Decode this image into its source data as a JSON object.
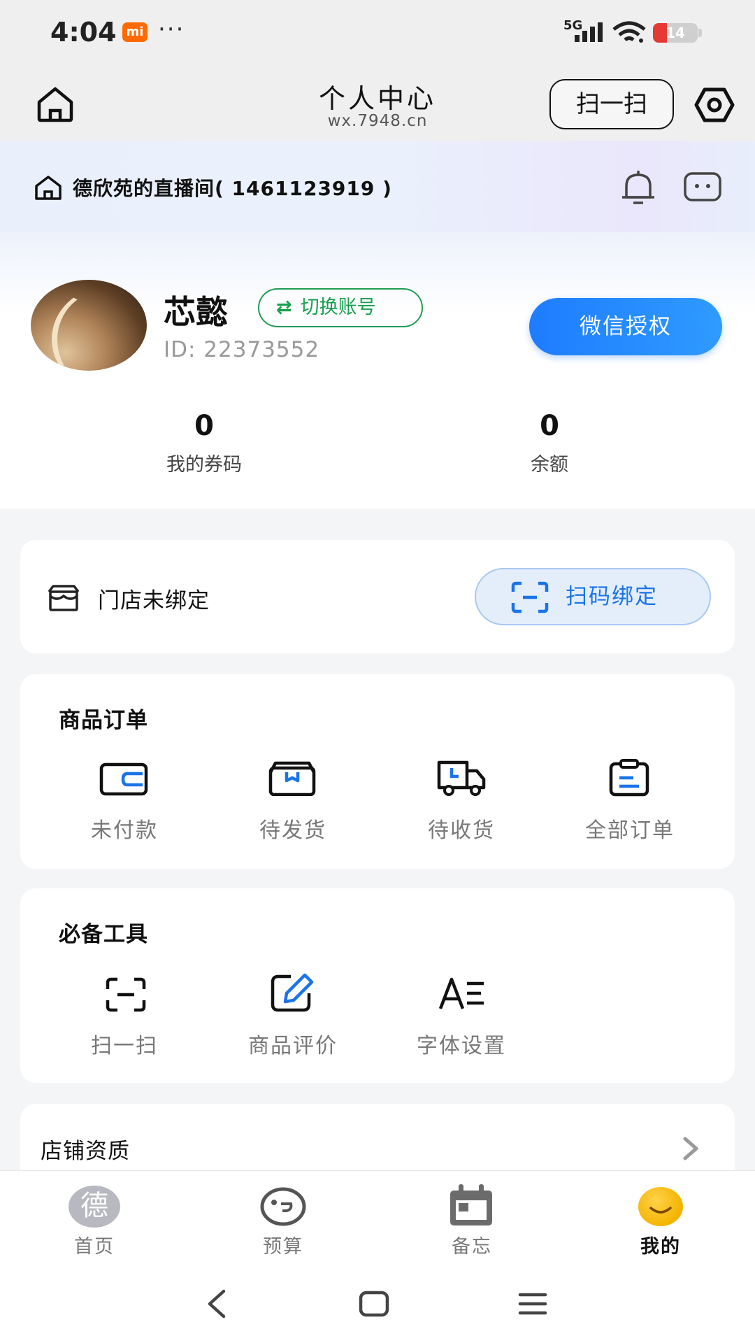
{
  "status_bar": {
    "time": "4:04",
    "mi_badge": "mi",
    "more": "···",
    "network": "5G",
    "battery": "14",
    "battery_level": 0.14,
    "battery_color": "#e53935"
  },
  "header": {
    "title": "个人中心",
    "subtitle": "wx.7948.cn",
    "scan_button": "扫一扫",
    "icons": [
      "home-icon",
      "settings-gear-icon"
    ]
  },
  "banner": {
    "live_room": "德欣苑的直播间( 1461123919 )",
    "icons": [
      "bell-icon",
      "message-icon"
    ]
  },
  "profile": {
    "name": "芯懿",
    "switch_button": "切换账号",
    "id_text": "ID: 22373552",
    "wechat_button": "微信授权",
    "stats": [
      {
        "value": "0",
        "label": "我的券码"
      },
      {
        "value": "0",
        "label": "余额"
      }
    ]
  },
  "store": {
    "text": "门店未绑定",
    "bind_button": "扫码绑定"
  },
  "orders": {
    "title": "商品订单",
    "items": [
      {
        "label": "未付款",
        "icon": "wallet-icon"
      },
      {
        "label": "待发货",
        "icon": "package-icon"
      },
      {
        "label": "待收货",
        "icon": "delivery-truck-icon"
      },
      {
        "label": "全部订单",
        "icon": "clipboard-icon"
      }
    ]
  },
  "tools": {
    "title": "必备工具",
    "items": [
      {
        "label": "扫一扫",
        "icon": "scan-icon"
      },
      {
        "label": "商品评价",
        "icon": "edit-review-icon"
      },
      {
        "label": "字体设置",
        "icon": "font-settings-icon"
      }
    ]
  },
  "qualification": {
    "title": "店铺资质"
  },
  "tabbar": {
    "items": [
      {
        "label": "首页",
        "badge": "德"
      },
      {
        "label": "预算"
      },
      {
        "label": "备忘"
      },
      {
        "label": "我的"
      }
    ],
    "active": "我的"
  },
  "colors": {
    "accent_blue": "#1e7cff",
    "switch_green": "#17a050",
    "icon_blue": "#1a74e8"
  }
}
